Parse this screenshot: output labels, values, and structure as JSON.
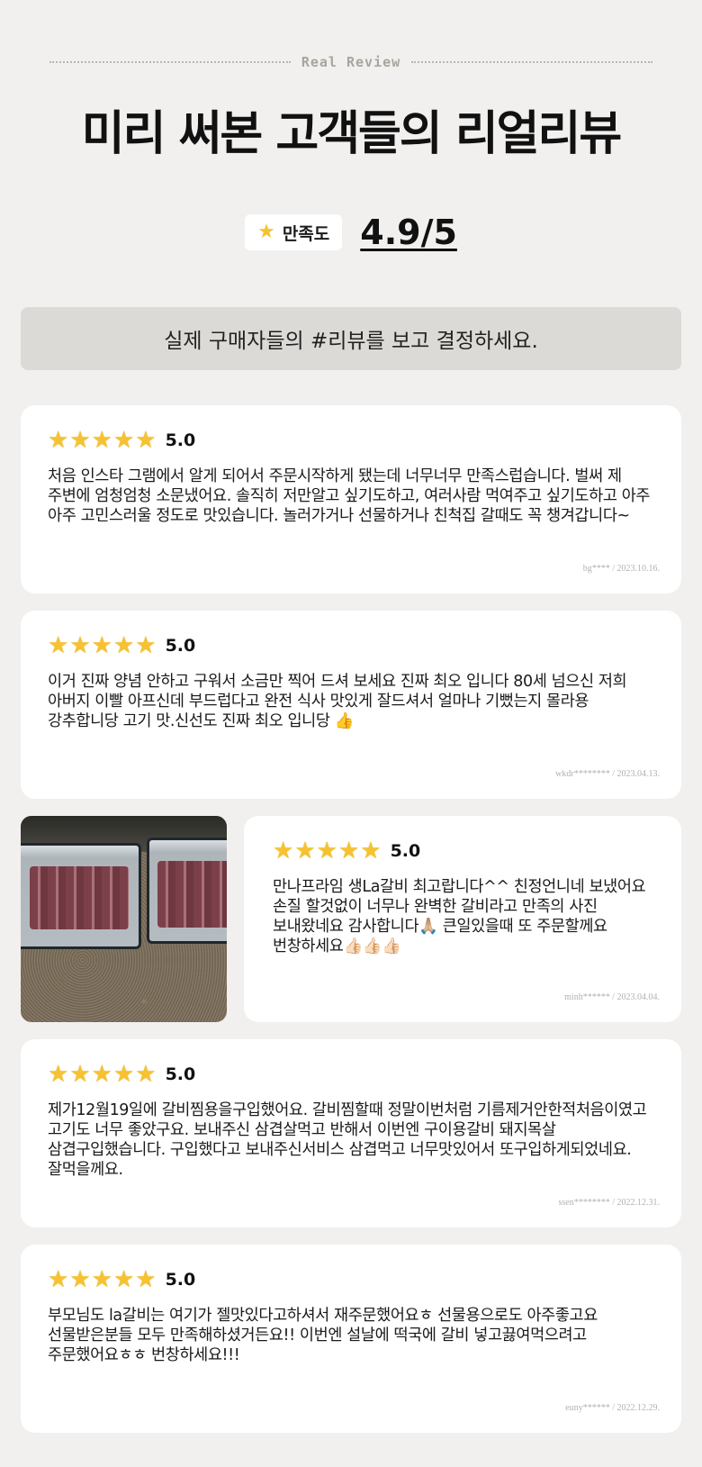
{
  "header": {
    "tagline": "Real Review",
    "title": "미리 써본 고객들의 리얼리뷰",
    "satisfaction_label": "만족도",
    "score": "4.9/5"
  },
  "banner": {
    "text": "실제 구매자들의 #리뷰를 보고 결정하세요."
  },
  "colors": {
    "star": "#f6c231",
    "background": "#f1f0ee",
    "banner": "#dcdad6"
  },
  "reviews": [
    {
      "rating": "5.0",
      "text": "처음 인스타 그램에서 알게 되어서 주문시작하게 됐는데 너무너무 만족스럽습니다. 벌써 제 주변에 엄청엄청 소문냈어요. 솔직히 저만알고 싶기도하고, 여러사람 먹여주고 싶기도하고 아주 아주 고민스러울 정도로 맛있습니다. 놀러가거나 선물하거나 친척집 갈때도 꼭 챙겨갑니다~",
      "meta": "bg**** / 2023.10.16."
    },
    {
      "rating": "5.0",
      "text": "이거 진짜 양념 안하고 구워서 소금만 찍어 드셔 보세요 진짜 최오 입니다 80세 넘으신 저희 아버지 이빨 아프신데 부드럽다고 완전 식사 맛있게 잘드셔서 얼마나 기뻤는지 몰라용 강추합니당 고기 맛.신선도 진짜 최오 입니당 👍",
      "meta": "wkdr******** / 2023.04.13."
    },
    {
      "rating": "5.0",
      "text": "만나프라임 생La갈비 최고랍니다^^ 친정언니네 보냈어요 손질 할것없이 너무나 완벽한 갈비라고 만족의 사진 보내왔네요 감사합니다🙏🏼 큰일있을때 또 주문할께요 번창하세요👍🏻👍🏻👍🏻",
      "meta": "minh****** / 2023.04.04."
    },
    {
      "rating": "5.0",
      "text": "제가12월19일에 갈비찜용을구입했어요. 갈비찜할때 정말이번처럼 기름제거안한적처음이였고 고기도 너무 좋았구요. 보내주신 삼겹살먹고 반해서 이번엔 구이용갈비 돼지목살 삼겹구입했습니다. 구입했다고 보내주신서비스 삼겹먹고 너무맛있어서 또구입하게되었네요.잘먹을께요.",
      "meta": "ssen******** / 2022.12.31."
    },
    {
      "rating": "5.0",
      "text": "부모님도 la갈비는 여기가 젤맛있다고하셔서 재주문했어요ㅎ 선물용으로도 아주좋고요 선물받은분들 모두 만족해하셨거든요!! 이번엔 설날에 떡국에 갈비 넣고끓여먹으려고 주문했어요ㅎㅎ 번창하세요!!!",
      "meta": "euny****** / 2022.12.29."
    }
  ]
}
